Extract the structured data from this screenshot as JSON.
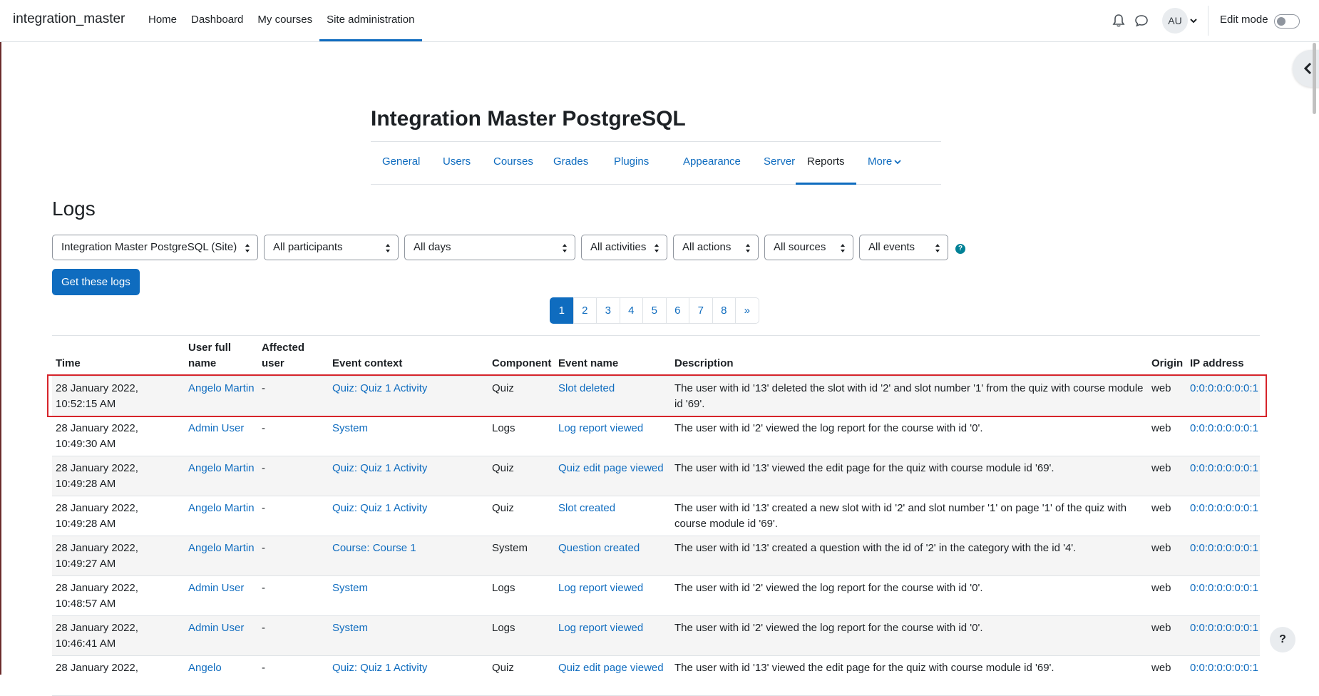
{
  "navbar": {
    "brand": "integration_master",
    "items": [
      {
        "label": "Home"
      },
      {
        "label": "Dashboard"
      },
      {
        "label": "My courses"
      },
      {
        "label": "Site administration",
        "active": true
      }
    ],
    "avatar_initials": "AU",
    "edit_mode_label": "Edit mode",
    "edit_mode_on": false
  },
  "page": {
    "title": "Integration Master PostgreSQL",
    "heading": "Logs"
  },
  "secondary_nav": {
    "items": [
      {
        "label": "General"
      },
      {
        "label": "Users"
      },
      {
        "label": "Courses"
      },
      {
        "label": "Grades"
      },
      {
        "label": "Plugins"
      },
      {
        "label": "Appearance"
      },
      {
        "label": "Server"
      },
      {
        "label": "Reports",
        "active": true
      },
      {
        "label": "More"
      }
    ]
  },
  "filters": {
    "site": "Integration Master PostgreSQL (Site)",
    "participants": "All participants",
    "days": "All days",
    "activities": "All activities",
    "actions": "All actions",
    "sources": "All sources",
    "events": "All events",
    "help": "?",
    "submit_label": "Get these logs"
  },
  "pagination": {
    "pages": [
      "1",
      "2",
      "3",
      "4",
      "5",
      "6",
      "7",
      "8"
    ],
    "current": "1",
    "next": "»"
  },
  "table": {
    "headers": {
      "time": "Time",
      "user_full_name": "User full name",
      "affected_user": "Affected user",
      "event_context": "Event context",
      "component": "Component",
      "event_name": "Event name",
      "description": "Description",
      "origin": "Origin",
      "ip_address": "IP address"
    },
    "rows": [
      {
        "time": "28 January 2022, 10:52:15 AM",
        "user": "Angelo Martin",
        "affected": "-",
        "context": "Quiz: Quiz 1 Activity",
        "component": "Quiz",
        "event": "Slot deleted",
        "description": "The user with id '13' deleted the slot with id '2' and slot number '1' from the quiz with course module id '69'.",
        "origin": "web",
        "ip": "0:0:0:0:0:0:0:1"
      },
      {
        "time": "28 January 2022, 10:49:30 AM",
        "user": "Admin User",
        "affected": "-",
        "context": "System",
        "component": "Logs",
        "event": "Log report viewed",
        "description": "The user with id '2' viewed the log report for the course with id '0'.",
        "origin": "web",
        "ip": "0:0:0:0:0:0:0:1"
      },
      {
        "time": "28 January 2022, 10:49:28 AM",
        "user": "Angelo Martin",
        "affected": "-",
        "context": "Quiz: Quiz 1 Activity",
        "component": "Quiz",
        "event": "Quiz edit page viewed",
        "description": "The user with id '13' viewed the edit page for the quiz with course module id '69'.",
        "origin": "web",
        "ip": "0:0:0:0:0:0:0:1"
      },
      {
        "time": "28 January 2022, 10:49:28 AM",
        "user": "Angelo Martin",
        "affected": "-",
        "context": "Quiz: Quiz 1 Activity",
        "component": "Quiz",
        "event": "Slot created",
        "description": "The user with id '13' created a new slot with id '2' and slot number '1' on page '1' of the quiz with course module id '69'.",
        "origin": "web",
        "ip": "0:0:0:0:0:0:0:1"
      },
      {
        "time": "28 January 2022, 10:49:27 AM",
        "user": "Angelo Martin",
        "affected": "-",
        "context": "Course: Course 1",
        "component": "System",
        "event": "Question created",
        "description": "The user with id '13' created a question with the id of '2' in the category with the id '4'.",
        "origin": "web",
        "ip": "0:0:0:0:0:0:0:1"
      },
      {
        "time": "28 January 2022, 10:48:57 AM",
        "user": "Admin User",
        "affected": "-",
        "context": "System",
        "component": "Logs",
        "event": "Log report viewed",
        "description": "The user with id '2' viewed the log report for the course with id '0'.",
        "origin": "web",
        "ip": "0:0:0:0:0:0:0:1"
      },
      {
        "time": "28 January 2022, 10:46:41 AM",
        "user": "Admin User",
        "affected": "-",
        "context": "System",
        "component": "Logs",
        "event": "Log report viewed",
        "description": "The user with id '2' viewed the log report for the course with id '0'.",
        "origin": "web",
        "ip": "0:0:0:0:0:0:0:1"
      },
      {
        "time": "28 January 2022,",
        "user": "Angelo",
        "affected": "-",
        "context": "Quiz: Quiz 1 Activity",
        "component": "Quiz",
        "event": "Quiz edit page viewed",
        "description": "The user with id '13' viewed the edit page for the quiz with course module id '69'.",
        "origin": "web",
        "ip": "0:0:0:0:0:0:0:1"
      }
    ]
  },
  "floating_help": "?",
  "colors": {
    "link": "#0f6cbf",
    "primary_button": "#0f6cbf",
    "highlight_border": "#d6242a",
    "row_stripe": "#f5f5f5"
  },
  "icons": {
    "notifications": "bell-icon",
    "messages": "chat-icon",
    "user_menu": "chevron-down-icon",
    "drawer": "chevron-left-icon",
    "help": "question-circle-icon"
  }
}
